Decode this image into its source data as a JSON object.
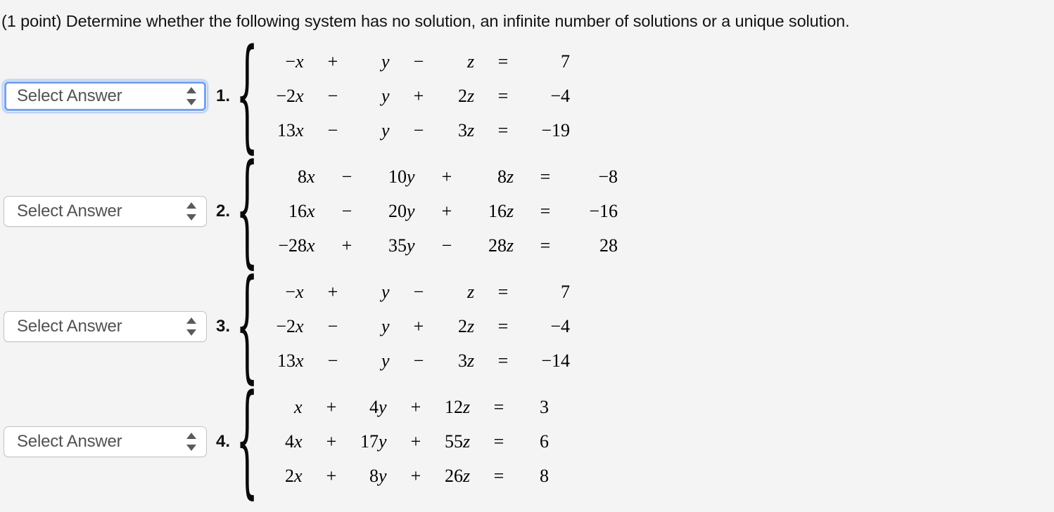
{
  "prompt": "(1 point) Determine whether the following system has no solution, an infinite number of solutions or a unique solution.",
  "colors": {
    "page_background": "#f4f4f4",
    "select_background": "#ffffff",
    "select_border": "#c3c3c3",
    "select_focus_ring": "#74a2ef",
    "select_text": "#525252",
    "text": "#121212"
  },
  "select_placeholder": "Select Answer",
  "stepper_icon": "up-down-stepper-icon",
  "problems": [
    {
      "index": "1.",
      "select": {
        "value": "Select Answer",
        "focused": true
      },
      "equations": [
        {
          "c1": "−",
          "v1": "x",
          "op1": "+",
          "c2": "",
          "v2": "y",
          "op2": "−",
          "c3": "",
          "v3": "z",
          "eq": "=",
          "rhs": "7"
        },
        {
          "c1": "−2",
          "v1": "x",
          "op1": "−",
          "c2": "",
          "v2": "y",
          "op2": "+",
          "c3": "2",
          "v3": "z",
          "eq": "=",
          "rhs": "−4"
        },
        {
          "c1": "13",
          "v1": "x",
          "op1": "−",
          "c2": "",
          "v2": "y",
          "op2": "−",
          "c3": "3",
          "v3": "z",
          "eq": "=",
          "rhs": "−19"
        }
      ]
    },
    {
      "index": "2.",
      "select": {
        "value": "Select Answer",
        "focused": false
      },
      "equations": [
        {
          "c1": "8",
          "v1": "x",
          "op1": "−",
          "c2": "10",
          "v2": "y",
          "op2": "+",
          "c3": "8",
          "v3": "z",
          "eq": "=",
          "rhs": "−8"
        },
        {
          "c1": "16",
          "v1": "x",
          "op1": "−",
          "c2": "20",
          "v2": "y",
          "op2": "+",
          "c3": "16",
          "v3": "z",
          "eq": "=",
          "rhs": "−16"
        },
        {
          "c1": "−28",
          "v1": "x",
          "op1": "+",
          "c2": "35",
          "v2": "y",
          "op2": "−",
          "c3": "28",
          "v3": "z",
          "eq": "=",
          "rhs": "28"
        }
      ]
    },
    {
      "index": "3.",
      "select": {
        "value": "Select Answer",
        "focused": false
      },
      "equations": [
        {
          "c1": "−",
          "v1": "x",
          "op1": "+",
          "c2": "",
          "v2": "y",
          "op2": "−",
          "c3": "",
          "v3": "z",
          "eq": "=",
          "rhs": "7"
        },
        {
          "c1": "−2",
          "v1": "x",
          "op1": "−",
          "c2": "",
          "v2": "y",
          "op2": "+",
          "c3": "2",
          "v3": "z",
          "eq": "=",
          "rhs": "−4"
        },
        {
          "c1": "13",
          "v1": "x",
          "op1": "−",
          "c2": "",
          "v2": "y",
          "op2": "−",
          "c3": "3",
          "v3": "z",
          "eq": "=",
          "rhs": "−14"
        }
      ]
    },
    {
      "index": "4.",
      "select": {
        "value": "Select Answer",
        "focused": false
      },
      "equations": [
        {
          "c1": "",
          "v1": "x",
          "op1": "+",
          "c2": "4",
          "v2": "y",
          "op2": "+",
          "c3": "12",
          "v3": "z",
          "eq": "=",
          "rhs": "3"
        },
        {
          "c1": "4",
          "v1": "x",
          "op1": "+",
          "c2": "17",
          "v2": "y",
          "op2": "+",
          "c3": "55",
          "v3": "z",
          "eq": "=",
          "rhs": "6"
        },
        {
          "c1": "2",
          "v1": "x",
          "op1": "+",
          "c2": "8",
          "v2": "y",
          "op2": "+",
          "c3": "26",
          "v3": "z",
          "eq": "=",
          "rhs": "8"
        }
      ]
    }
  ]
}
